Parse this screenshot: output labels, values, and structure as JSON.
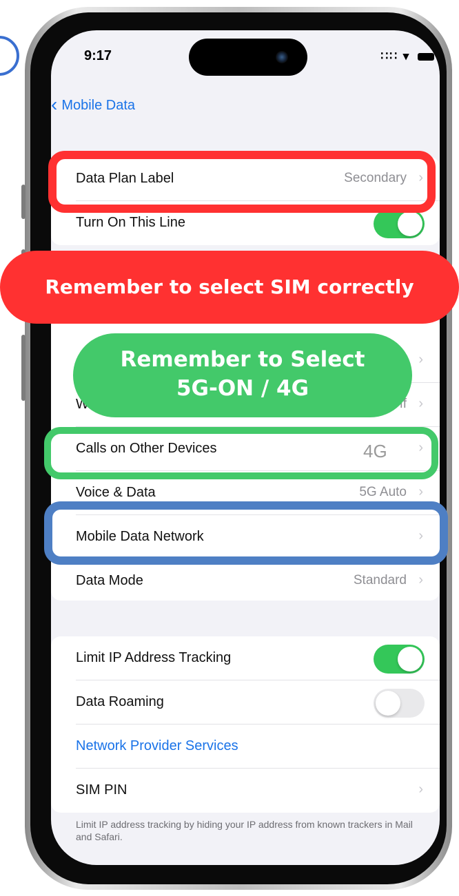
{
  "status_bar": {
    "time": "9:17",
    "icons": "∷∷ ▾"
  },
  "nav": {
    "back_label": "Mobile Data"
  },
  "section1": {
    "rows": [
      {
        "label": "Data Plan Label",
        "value": "Secondary"
      },
      {
        "label": "Turn On This Line",
        "toggle": "on"
      }
    ]
  },
  "section2": {
    "rows": [
      {
        "label": "",
        "value": ""
      },
      {
        "label": "W",
        "value": "ff"
      },
      {
        "label": "Calls on Other Devices",
        "value": ""
      },
      {
        "label": "Voice & Data",
        "value": "5G Auto"
      },
      {
        "label": "Mobile Data Network",
        "value": ""
      },
      {
        "label": "Data Mode",
        "value": "Standard"
      }
    ]
  },
  "section3": {
    "rows": [
      {
        "label": "Limit IP Address Tracking",
        "toggle": "on"
      },
      {
        "label": "Data Roaming",
        "toggle": "off"
      },
      {
        "label": "Network Provider Services"
      },
      {
        "label": "SIM PIN"
      }
    ]
  },
  "footer_text": "Limit IP address tracking by hiding your IP address from known trackers in Mail and Safari.",
  "annotations": {
    "sim_banner": "Remember to select SIM correctly",
    "network_banner_line1": "Remember to Select",
    "network_banner_line2": "5G-ON / 4G",
    "fourg_label": "4G"
  },
  "colors": {
    "toggle_on": "#34c759",
    "link_blue": "#1a73e8",
    "highlight_red": "#ff3131",
    "highlight_green": "#43c96a",
    "highlight_blue": "#4e7fc4"
  }
}
